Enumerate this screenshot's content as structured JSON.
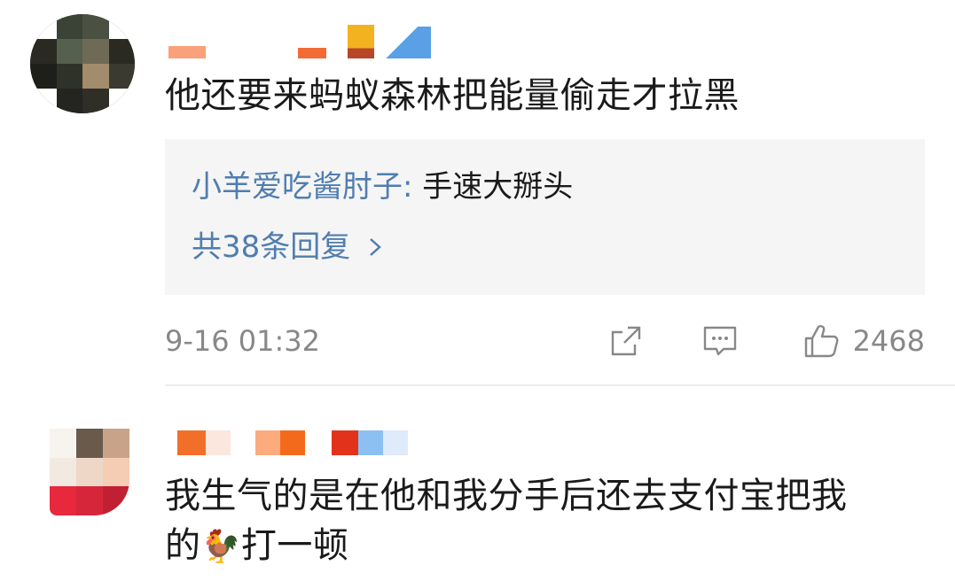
{
  "comments": [
    {
      "text": "他还要来蚂蚁森林把能量偷走才拉黑",
      "reply_preview": {
        "author": "小羊爱吃酱肘子",
        "separator": ":",
        "content": "手速大掰头",
        "more_label": "共38条回复",
        "more_icon": "chevron-right-icon"
      },
      "timestamp": "9-16 01:32",
      "actions": {
        "share_icon": "share-icon",
        "reply_icon": "comment-icon",
        "like_icon": "thumbs-up-icon",
        "like_count": "2468"
      }
    },
    {
      "text_line1": "我生气的是在他和我分手后还去支付宝把我",
      "text_line2_before": "的",
      "text_line2_emoji": "🐓",
      "text_line2_after": "打一顿"
    }
  ],
  "colors": {
    "link": "#507daf",
    "meta": "#888888",
    "reply_bg": "#f5f5f5"
  }
}
